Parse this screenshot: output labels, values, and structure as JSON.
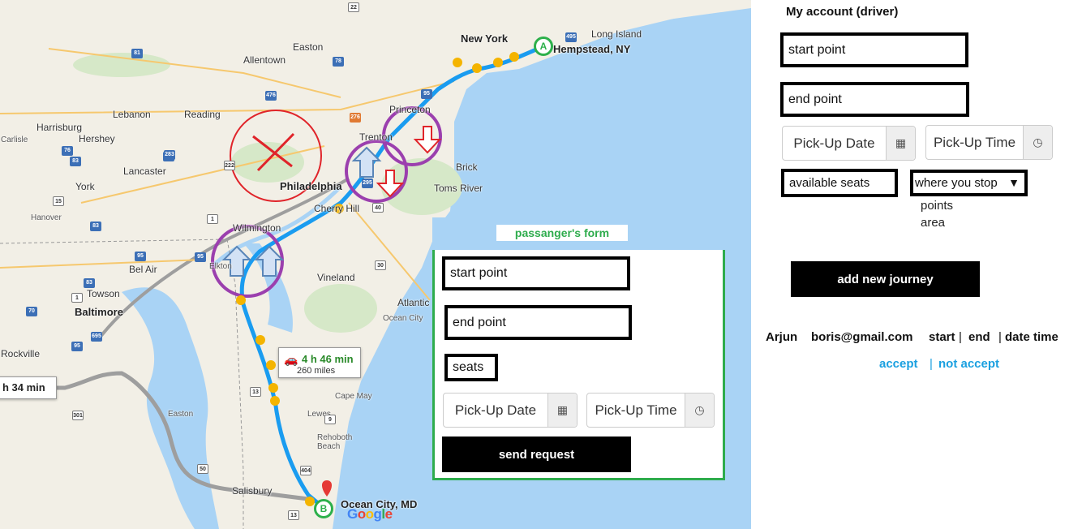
{
  "map": {
    "places": {
      "new_york": "New York",
      "hempstead": "Hempstead, NY",
      "long_island": "Long Island",
      "allentown": "Allentown",
      "easton": "Easton",
      "lebanon": "Lebanon",
      "reading": "Reading",
      "harrisburg": "Harrisburg",
      "hershey": "Hershey",
      "carlisle": "Carlisle",
      "lancaster": "Lancaster",
      "york": "York",
      "hanover": "Hanover",
      "princeton": "Princeton",
      "trenton": "Trenton",
      "brick": "Brick",
      "toms_river": "Toms River",
      "philadelphia": "Philadelphia",
      "cherry_hill": "Cherry Hill",
      "wilmington": "Wilmington",
      "elkton": "Elkton",
      "bel_air": "Bel Air",
      "towson": "Towson",
      "baltimore": "Baltimore",
      "rockville": "Rockville",
      "vineland": "Vineland",
      "atlantic": "Atlantic",
      "ocean_city_nj": "Ocean City",
      "cape_may": "Cape May",
      "easton_md": "Easton",
      "lewes": "Lewes",
      "rehoboth": "Rehoboth",
      "beach": "Beach",
      "salisbury": "Salisbury",
      "ocean_city_md": "Ocean City, MD"
    },
    "shields": [
      "495",
      "81",
      "78",
      "22",
      "476",
      "276",
      "78",
      "222",
      "76",
      "83",
      "15",
      "83",
      "283",
      "1",
      "95",
      "295",
      "95",
      "40",
      "30",
      "95",
      "1",
      "83",
      "70",
      "695",
      "95",
      "13",
      "301",
      "50",
      "13",
      "9",
      "404"
    ],
    "marker_a": "A",
    "marker_b": "B",
    "duration_main": "4 h 46 min",
    "distance_main": "260 miles",
    "duration_alt": "h 34 min",
    "google_letters": [
      "G",
      "o",
      "o",
      "g",
      "l",
      "e"
    ]
  },
  "passenger_form": {
    "title": "passanger's form",
    "start_point": "start point",
    "end_point": "end  point",
    "seats": "seats",
    "pickup_date": "Pick-Up Date",
    "pickup_time": "Pick-Up Time",
    "send_button": "send request"
  },
  "driver": {
    "title": "My account (driver)",
    "start_point": "start point",
    "end_point": "end  point",
    "pickup_date": "Pick-Up Date",
    "pickup_time": "Pick-Up Time",
    "available_seats": "available seats",
    "stops_select": "where you stop",
    "stops_options": [
      "points",
      "area"
    ],
    "add_button": "add new journey"
  },
  "request": {
    "name": "Arjun",
    "email": "boris@gmail.com",
    "start": "start",
    "sep1": "|",
    "end": "end",
    "sep2": "|",
    "datetime": "date time",
    "accept": "accept",
    "sep3": "|",
    "not_accept": "not accept"
  },
  "colors": {
    "route": "#1a9cf0",
    "alt_route": "#9e9e9e",
    "ocean": "#a9d3f5",
    "form_border": "#2eac4d",
    "link": "#1aa0e0",
    "annotation_circle": "#9b3fae",
    "annotation_cross": "#e0242a"
  }
}
